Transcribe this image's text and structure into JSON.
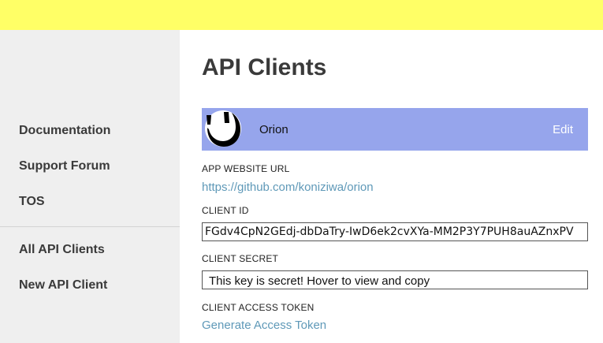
{
  "sidebar": {
    "items": [
      {
        "label": "Documentation"
      },
      {
        "label": "Support Forum"
      },
      {
        "label": "TOS"
      },
      {
        "label": "All API Clients"
      },
      {
        "label": "New API Client"
      }
    ]
  },
  "main": {
    "title": "API Clients",
    "client": {
      "name": "Orion",
      "edit_label": "Edit",
      "avatar_icon": "smiling-face-logo-icon"
    },
    "fields": {
      "app_website_url_label": "APP WEBSITE URL",
      "app_website_url": "https://github.com/koniziwa/orion",
      "client_id_label": "CLIENT ID",
      "client_id": "FGdv4CpN2GEdj-dbDaTry-IwD6ek2cvXYa-MM2P3Y7PUH8auAZnxPV",
      "client_secret_label": "CLIENT SECRET",
      "client_secret": "This key is secret! Hover to view and copy",
      "client_access_token_label": "CLIENT ACCESS TOKEN",
      "generate_token_label": "Generate Access Token"
    }
  },
  "colors": {
    "topbar": "#ffff66",
    "sidebar": "#efefef",
    "client_bar": "#96a5ec",
    "link": "#5f99b8"
  }
}
